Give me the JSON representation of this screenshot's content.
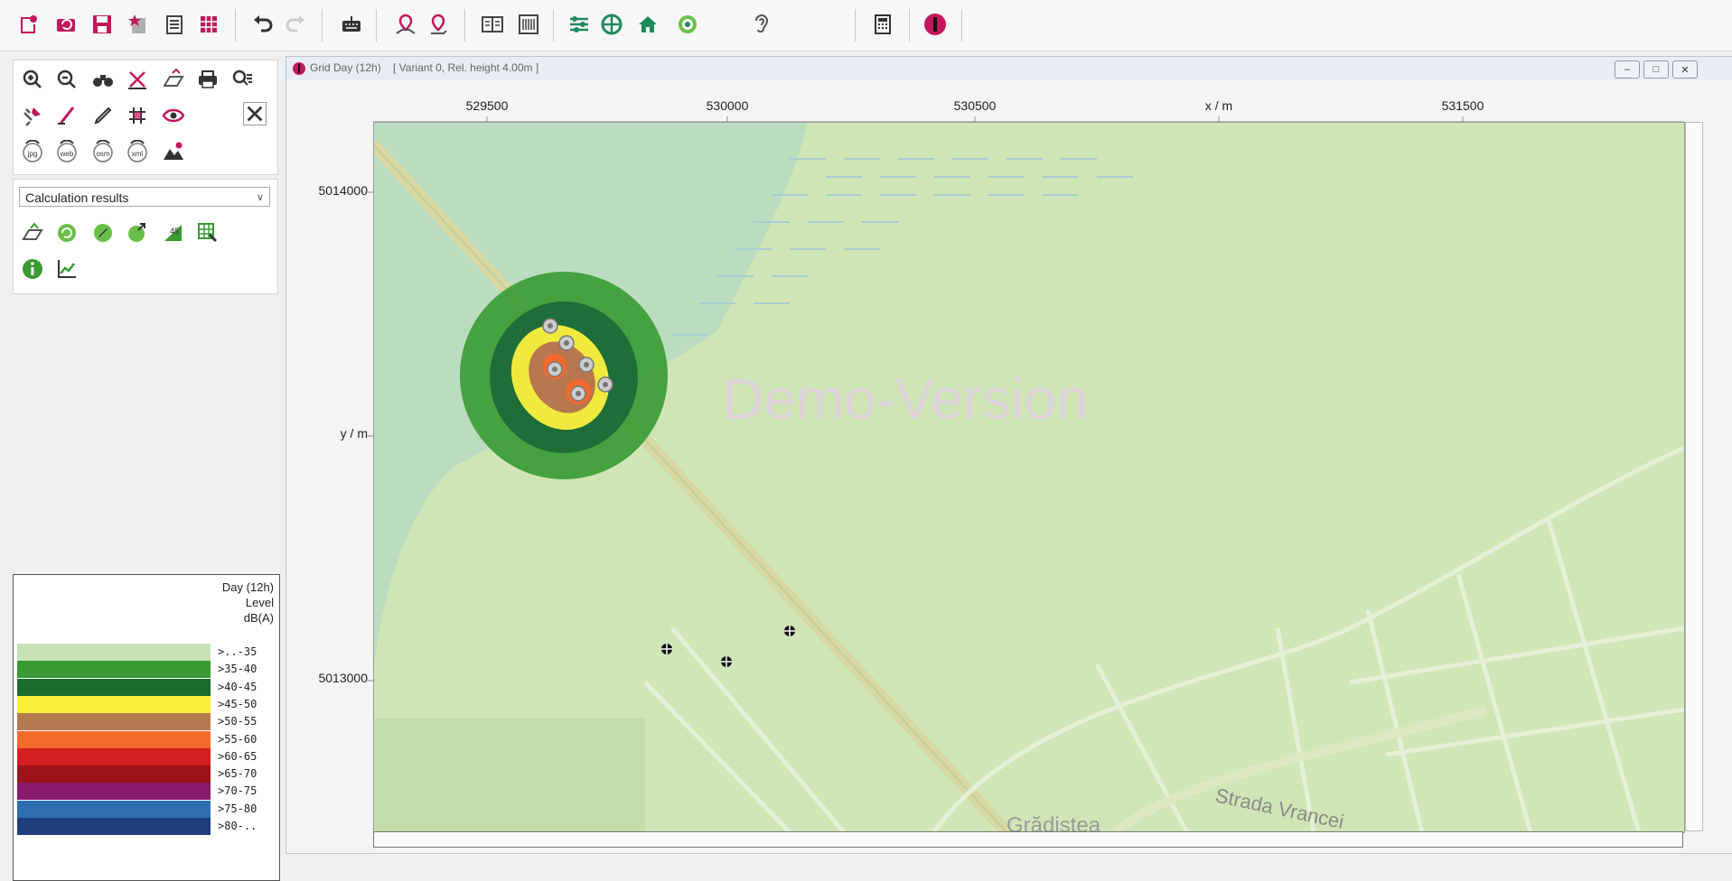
{
  "toolbar": {
    "icons": [
      "new-project-icon",
      "open-project-icon",
      "save-icon",
      "favorites-icon",
      "list-icon",
      "grid-icon",
      "undo-icon",
      "redo-icon",
      "keyboard-icon",
      "place-marker-icon",
      "move-marker-icon",
      "book-icon",
      "barcode-icon",
      "settings-sliders-icon",
      "crosshair-icon",
      "house-icon",
      "target-icon",
      "ear-icon",
      "calculator-icon",
      "logo-icon"
    ]
  },
  "tools": {
    "icons": [
      "zoom-in-icon",
      "zoom-out-icon",
      "binoculars-icon",
      "measure-icon",
      "layer-icon",
      "print-icon",
      "zoom-list-icon",
      "satellite-icon",
      "pen-icon",
      "pencil-icon",
      "grid-snap-icon",
      "eye-icon",
      "tools-icon",
      "export-jpg-icon",
      "export-web-icon",
      "export-osm-icon",
      "export-xml-icon",
      "terrain-icon"
    ],
    "export_labels": [
      "jpg",
      "web",
      "osm",
      "xml"
    ]
  },
  "calc_panel": {
    "dropdown_value": "Calculation results",
    "icons": [
      "results-layer-icon",
      "results-refresh-icon",
      "results-edit-icon",
      "results-export-icon",
      "results-45-icon",
      "results-table-icon",
      "info-icon",
      "chart-icon"
    ],
    "number_icon_label": "45"
  },
  "legend": {
    "title": "Day (12h)",
    "subtitle": "Level",
    "unit": "dB(A)",
    "items": [
      {
        "label": ">..-35",
        "color": "#c6e3b8"
      },
      {
        "label": ">35-40",
        "color": "#3a9a33"
      },
      {
        "label": ">40-45",
        "color": "#1a6b2e"
      },
      {
        "label": ">45-50",
        "color": "#f7ee3a"
      },
      {
        "label": ">50-55",
        "color": "#b57a4f"
      },
      {
        "label": ">55-60",
        "color": "#f36a2d"
      },
      {
        "label": ">60-65",
        "color": "#d1201f"
      },
      {
        "label": ">65-70",
        "color": "#9c1419"
      },
      {
        "label": ">70-75",
        "color": "#8a1a6e"
      },
      {
        "label": ">75-80",
        "color": "#2f6fb0"
      },
      {
        "label": ">80-..",
        "color": "#1e3f7a"
      }
    ]
  },
  "map_window": {
    "title": "Grid Day (12h)",
    "subtitle": "[ Variant 0, Rel. height  4.00m ]",
    "x_ticks": [
      "529500",
      "530000",
      "530500",
      "x / m",
      "531500"
    ],
    "y_ticks": [
      "5014000",
      "y / m",
      "5013000"
    ],
    "watermark": "Demo-Version",
    "street_label": "Strada Vrancei",
    "district_label": "Grădiștea"
  }
}
